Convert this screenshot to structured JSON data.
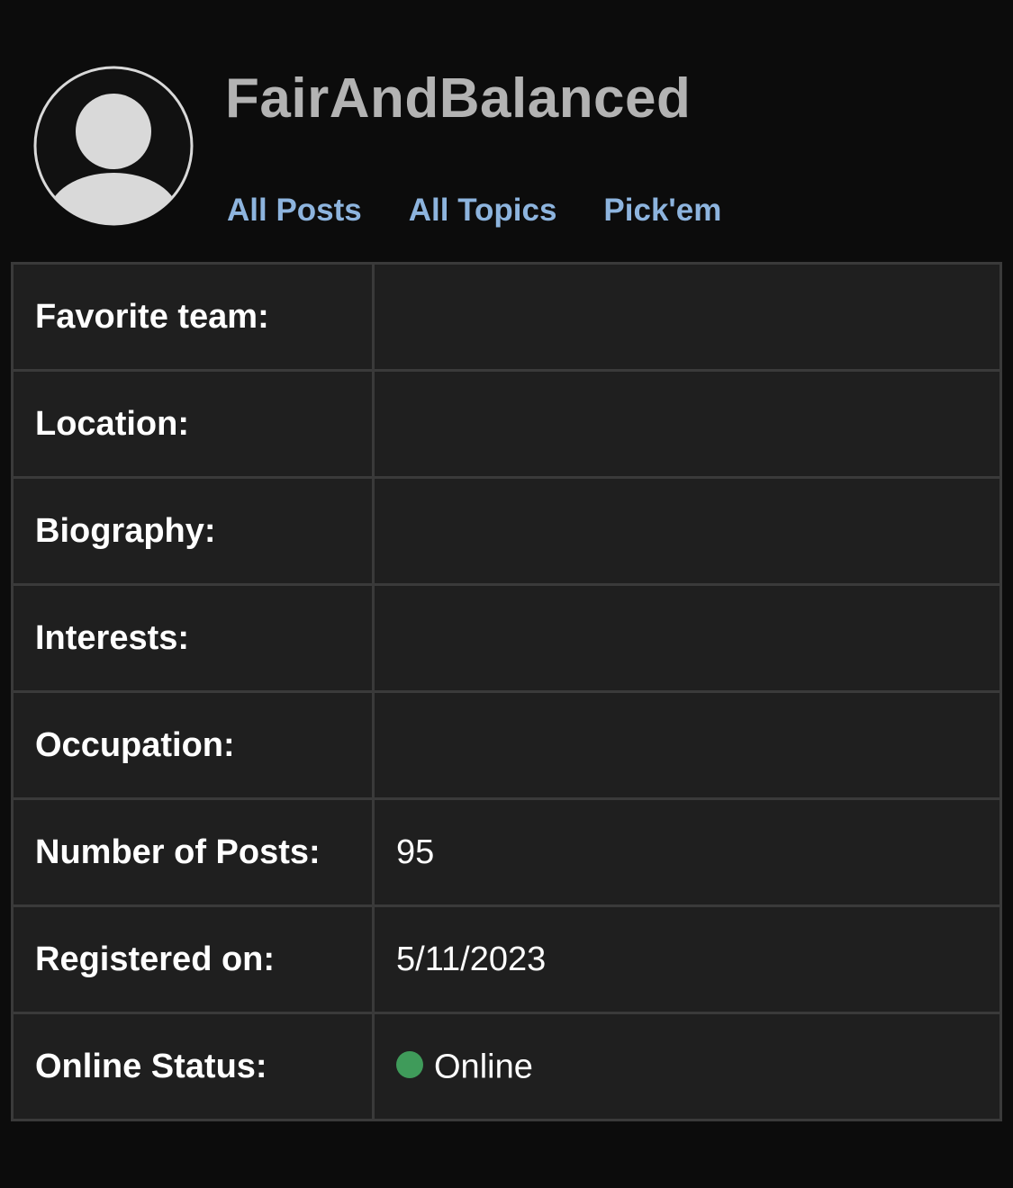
{
  "profile": {
    "username": "FairAndBalanced",
    "avatar_icon": "default-user-avatar-icon",
    "nav": {
      "all_posts": "All Posts",
      "all_topics": "All Topics",
      "pickem": "Pick'em"
    }
  },
  "info": {
    "rows": [
      {
        "label": "Favorite team:",
        "value": ""
      },
      {
        "label": "Location:",
        "value": ""
      },
      {
        "label": "Biography:",
        "value": ""
      },
      {
        "label": "Interests:",
        "value": ""
      },
      {
        "label": "Occupation:",
        "value": ""
      },
      {
        "label": "Number of Posts:",
        "value": "95"
      },
      {
        "label": "Registered on:",
        "value": "5/11/2023"
      },
      {
        "label": "Online Status:",
        "value": "Online"
      }
    ]
  },
  "colors": {
    "background": "#0c0c0c",
    "table_bg": "#1f1f1f",
    "border": "#3a3a3a",
    "link": "#8db4de",
    "username": "#b3b3b3",
    "online_dot": "#3f9b5a"
  }
}
